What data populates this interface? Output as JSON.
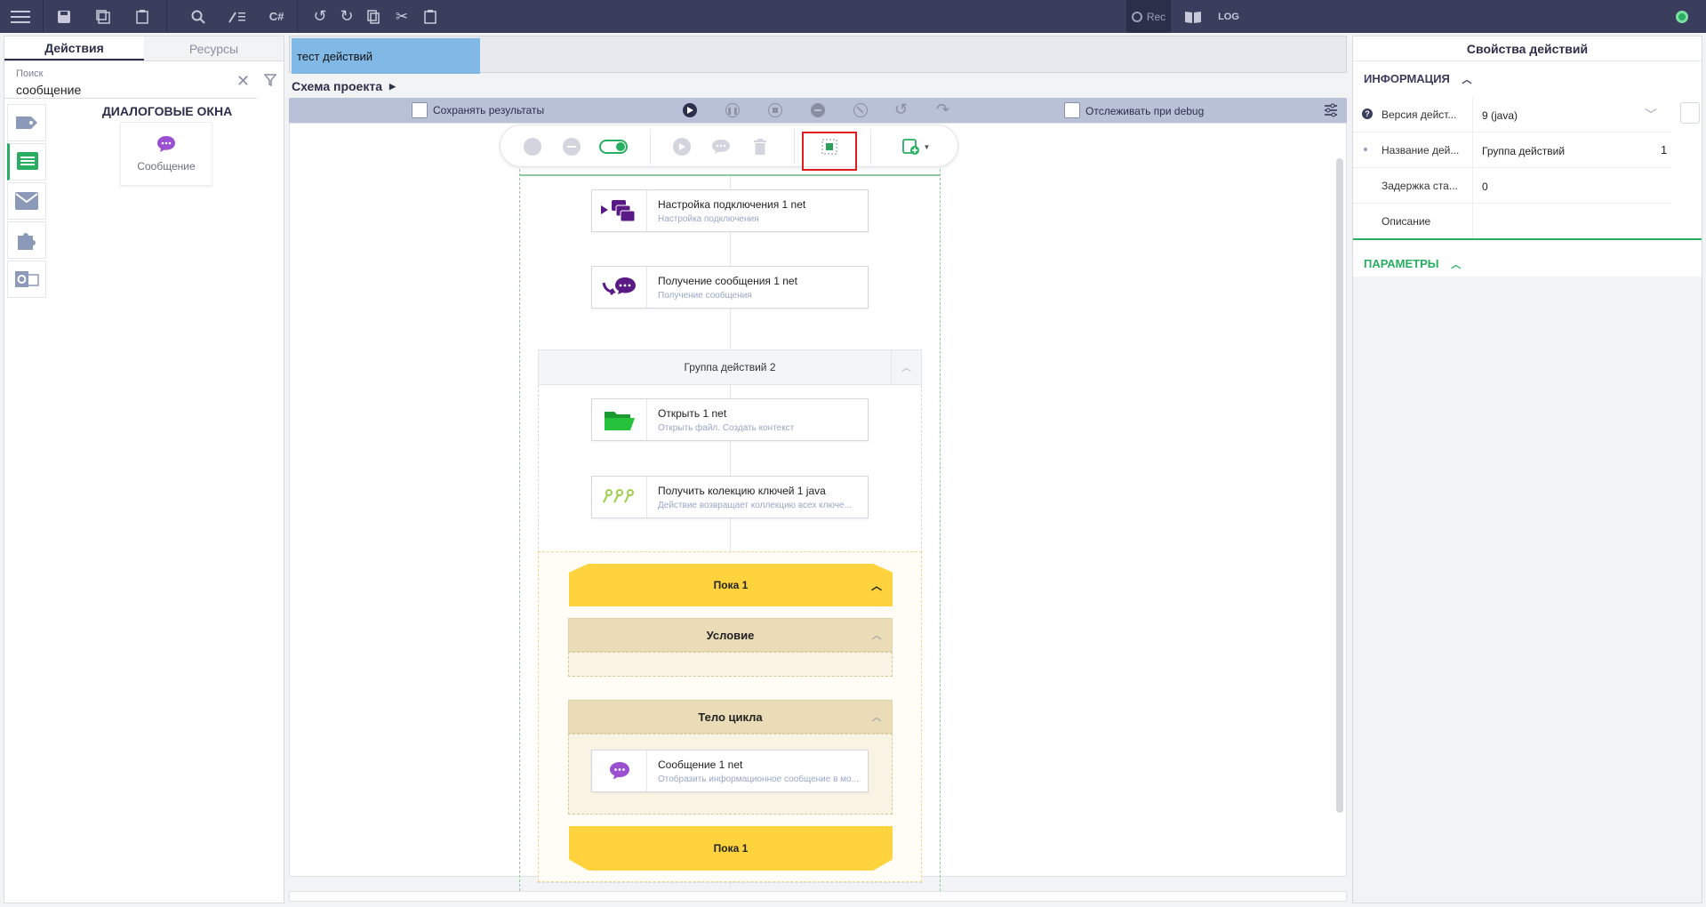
{
  "toolbar": {
    "rec_label": "Rec",
    "log_label": "LOG",
    "csharp_label": "C#"
  },
  "left_panel": {
    "tabs": [
      {
        "label": "Действия",
        "active": true
      },
      {
        "label": "Ресурсы",
        "active": false
      }
    ],
    "search": {
      "placeholder": "Поиск",
      "value": "сообщение"
    },
    "group_title": "ДИАЛОГОВЫЕ ОКНА",
    "items": [
      {
        "label": "Сообщение",
        "icon": "message-bubble-icon"
      }
    ],
    "categories": [
      "tag-icon",
      "dialog-icon",
      "mail-icon",
      "puzzle-icon",
      "outlook-icon"
    ]
  },
  "project_tab": {
    "label": "тест действий"
  },
  "breadcrumb": {
    "label": "Схема проекта"
  },
  "run_bar": {
    "save_results_label": "Сохранять результаты",
    "debug_track_label": "Отслеживать при debug"
  },
  "flow": {
    "nodes": [
      {
        "title": "Настройка подключения  1  net",
        "desc": "Настройка подключения",
        "icon": "connection-settings-icon"
      },
      {
        "title": "Получение сообщения  1  net",
        "desc": "Получение сообщения",
        "icon": "receive-message-icon"
      },
      {
        "title": "Открыть  1  net",
        "desc": "Открыть файл. Создать контекст",
        "icon": "open-folder-icon"
      },
      {
        "title": "Получить колекцию ключей  1  java",
        "desc": "Действие возвращает коллекцию всех ключе...",
        "icon": "keys-icon"
      },
      {
        "title": "Сообщение  1  net",
        "desc": "Отобразить информационное сообщение в мо...",
        "icon": "message-bubble-icon"
      }
    ],
    "group_label": "Группа действий  2",
    "loop_head_label": "Пока  1",
    "condition_label": "Условие",
    "body_label": "Тело цикла",
    "loop_foot_label": "Пока  1"
  },
  "right_panel": {
    "title": "Свойства действий",
    "info_section": "ИНФОРМАЦИЯ",
    "params_section": "ПАРАМЕТРЫ",
    "rows": [
      {
        "key": "Версия дейст...",
        "value": "9 (java)"
      },
      {
        "key": "Название дей...",
        "value": "Группа действий",
        "extra": "1"
      },
      {
        "key": "Задержка ста...",
        "value": "0"
      },
      {
        "key": "Описание",
        "value": ""
      }
    ]
  },
  "colors": {
    "topbar": "#3a3d5c",
    "accent_green": "#27ae60",
    "loop_yellow": "#ffd33d",
    "tab_blue": "#80b8e6",
    "purple_icon": "#7b2fa0"
  }
}
